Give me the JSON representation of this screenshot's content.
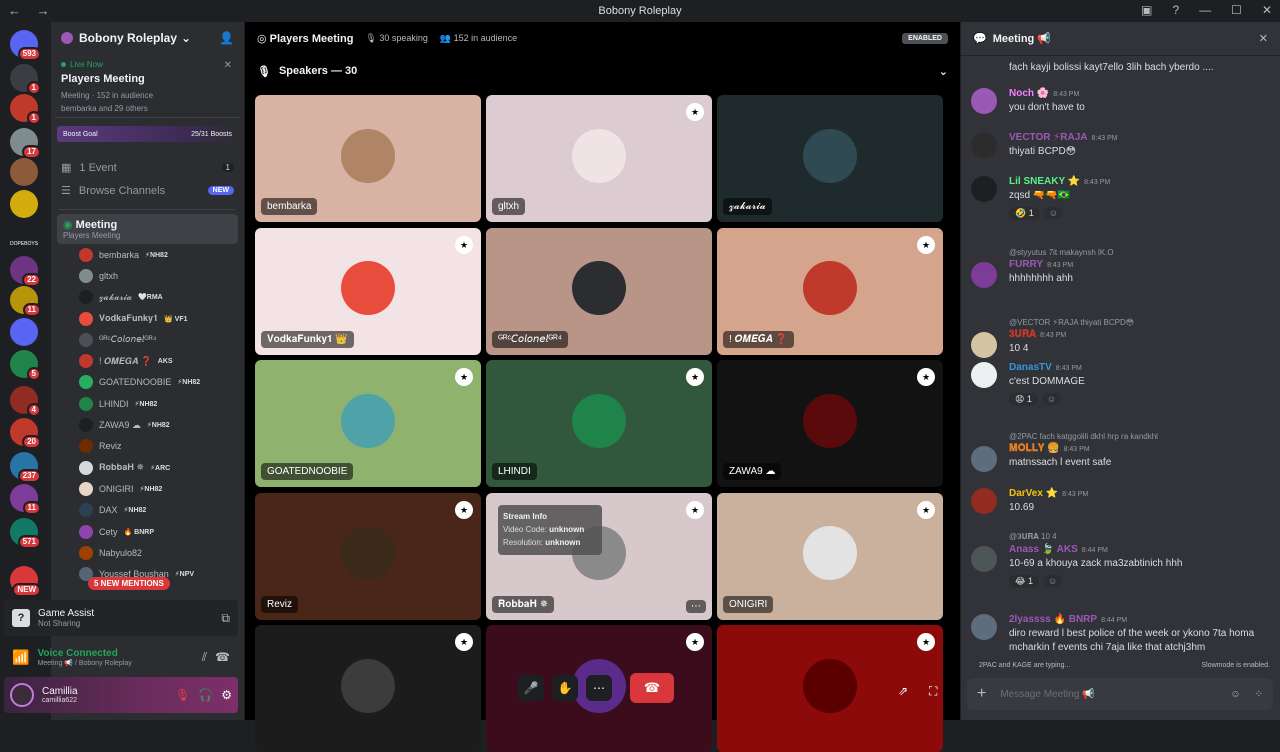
{
  "window": {
    "title": "Bobony Roleplay",
    "nav": "← →"
  },
  "guilds": [
    {
      "badge": "593",
      "color": "#5865f2"
    },
    {
      "badge": "1",
      "color": "#3a3d44"
    },
    {
      "badge": "1",
      "color": "#c0392b"
    },
    {
      "badge": "17",
      "color": "#7f8c8d"
    },
    {
      "badge": "",
      "color": "#8e5b3a"
    },
    {
      "badge": "",
      "color": "#d4ac0d"
    },
    {
      "label": "DOPEBOYS",
      "badge": "",
      "color": "#1e1f22"
    },
    {
      "badge": "22",
      "color": "#6c3483"
    },
    {
      "badge": "11",
      "color": "#b7950b"
    },
    {
      "badge": "",
      "color": "#5865f2"
    },
    {
      "badge": "5",
      "color": "#1e8449"
    },
    {
      "badge": "4",
      "color": "#922b21"
    },
    {
      "badge": "20",
      "color": "#c0392b"
    },
    {
      "badge": "237",
      "color": "#2874a6"
    },
    {
      "badge": "11",
      "color": "#7d3c98"
    },
    {
      "badge": "571",
      "color": "#117a65"
    },
    {
      "badge": "NEW",
      "color": "#da373c"
    }
  ],
  "server": {
    "name": "Bobony Roleplay",
    "live_label": "Live Now",
    "live_title": "Players Meeting",
    "live_meta_channel": "Meeting",
    "live_meta_audience": "152 in audience",
    "live_meta_members": "bembarka and 29 others",
    "boost_label": "Boost Goal",
    "boost_value": "25/31 Boosts",
    "events": "1 Event",
    "events_count": "1",
    "browse": "Browse Channels",
    "browse_badge": "NEW",
    "voice_channel": "Meeting",
    "voice_sub": "Players Meeting",
    "voice_users": [
      {
        "name": "bembarka",
        "tag": "⚡NH82",
        "color": "#c0392b"
      },
      {
        "name": "gltxh",
        "tag": "",
        "color": "#7f8c8d"
      },
      {
        "name": "𝔃𝓪𝓴𝓪𝓻𝓲𝓪",
        "tag": "🤍RMA",
        "color": "#1e1f22"
      },
      {
        "name": "𝐕𝐨𝐝𝐤𝐚𝐅𝐮𝐧𝐤𝐲𝟏",
        "tag": "👑 VF1",
        "color": "#e74c3c"
      },
      {
        "name": "ᴳᴿᶜ𝘊𝘰𝘭𝘰𝘯𝘦𝘭ᴳᴿ⁴",
        "tag": "",
        "color": "#4e5058"
      },
      {
        "name": "! 𝑶𝑴𝑬𝑮𝑨 ❓",
        "tag": "AKS",
        "color": "#c0392b"
      },
      {
        "name": "GOATEDNOOBIE",
        "tag": "⚡NH82",
        "color": "#27ae60"
      },
      {
        "name": "LHINDI",
        "tag": "⚡NH82",
        "color": "#1e8449"
      },
      {
        "name": "ZAWA9 ☁",
        "tag": "⚡NH82",
        "color": "#1e1f22"
      },
      {
        "name": "Reviz",
        "tag": "",
        "color": "#6e2c00"
      },
      {
        "name": "𝐑𝐨𝐛𝐛𝐚𝐇 ✵",
        "tag": "⚡ARC",
        "color": "#d5d8dc"
      },
      {
        "name": "ONIGIRI",
        "tag": "⚡NH82",
        "color": "#e8d5c4"
      },
      {
        "name": "DAX",
        "tag": "⚡NH82",
        "color": "#2e4053"
      },
      {
        "name": "Cety",
        "tag": "🔥 BNRP",
        "color": "#8e44ad"
      },
      {
        "name": "Nabyulo82",
        "tag": "",
        "color": "#a04000"
      },
      {
        "name": "Youssef Boushan",
        "tag": "⚡NPV",
        "color": "#566573"
      }
    ],
    "mentions": "5 NEW MENTIONS",
    "game_assist": "Game Assist",
    "game_assist_sub": "Not Sharing",
    "voice_connected": "Voice Connected",
    "voice_connected_sub": "Meeting 📢 / Bobony Roleplay",
    "user_name": "Camillia",
    "user_handle": "camillia622"
  },
  "stage": {
    "title": "Players Meeting",
    "speaking": "30 speaking",
    "audience": "152 in audience",
    "enabled": "ENABLED",
    "speakers": "Speakers — 30",
    "tiles": [
      {
        "name": "bembarka",
        "bg": "#d8b2a2",
        "av": "#b08566",
        "badge": false
      },
      {
        "name": "gltxh",
        "bg": "#dccbd0",
        "av": "#efe3e6",
        "badge": true
      },
      {
        "name": "𝔃𝓪𝓴𝓪𝓻𝓲𝓪",
        "bg": "#1f2a2c",
        "av": "#2f4a52",
        "badge": false
      },
      {
        "name": "𝐕𝐨𝐝𝐤𝐚𝐅𝐮𝐧𝐤𝐲𝟏 👑",
        "bg": "#f4e3e4",
        "av": "#e74c3c",
        "badge": true
      },
      {
        "name": "ᴳᴿᶜ𝘊𝘰𝘭𝘰𝘯𝘦𝘭ᴳᴿ⁴",
        "bg": "#b99588",
        "av": "#2b2d31",
        "badge": false
      },
      {
        "name": "! 𝑶𝑴𝑬𝑮𝑨 ❓",
        "bg": "#d5a48c",
        "av": "#c0392b",
        "badge": true
      },
      {
        "name": "GOATEDNOOBIE",
        "bg": "#8fb26f",
        "av": "#4fa3a8",
        "badge": true
      },
      {
        "name": "LHINDI",
        "bg": "#31573c",
        "av": "#1e8449",
        "badge": true
      },
      {
        "name": "ZAWA9 ☁",
        "bg": "#121212",
        "av": "#5a0a0a",
        "badge": true
      },
      {
        "name": "Reviz",
        "bg": "#4a2619",
        "av": "#3b2a1a",
        "badge": true
      },
      {
        "name": "𝐑𝐨𝐛𝐛𝐚𝐇 ✵",
        "bg": "#d7c9cb",
        "av": "#8a8a8a",
        "badge": true
      },
      {
        "name": "ONIGIRI",
        "bg": "#c9b19e",
        "av": "#e3e3e3",
        "badge": true
      },
      {
        "name": "",
        "bg": "#1c1c1c",
        "av": "#3c3c3c",
        "badge": true
      },
      {
        "name": "",
        "bg": "#3a0c1c",
        "av": "#5b2b8c",
        "badge": true
      },
      {
        "name": "",
        "bg": "#8c0a0a",
        "av": "#5a0000",
        "badge": true
      }
    ],
    "stream_info": {
      "title": "Stream Info",
      "codec_label": "Video Code:",
      "codec": "unknown",
      "res_label": "Resolution:",
      "res": "unknown"
    }
  },
  "chat": {
    "title": "Meeting 📢",
    "top_text": "fach kayji bolissi kayt7ello 3lih bach yberdo ....",
    "messages": [
      {
        "user": "Noch 🌸",
        "color": "#f47fff",
        "time": "8:43 PM",
        "text": "you don't have to",
        "av": "#9b59b6",
        "reply": "",
        "rx": ""
      },
      {
        "user": "VECTOR ⚡RAJA",
        "color": "#9b59b6",
        "time": "8:43 PM",
        "text": "thiyati BCPD😳",
        "av": "#2c2c2c",
        "reply": "",
        "rx": ""
      },
      {
        "user": "Lil SNEAKY ⭐",
        "color": "#57f287",
        "time": "8:43 PM",
        "text": "zqsd 🔫🔫🇧🇷",
        "av": "#1e1f22",
        "reply": "",
        "rx": "🤣 1"
      },
      {
        "user": "FURRY",
        "color": "#9b59b6",
        "time": "8:43 PM",
        "text": "hhhhhhhh ahh",
        "av": "#7d3c98",
        "reply": "@styyutus 7it makaynsh lK.O",
        "rx": ""
      },
      {
        "user": "𝟑𝐔𝐑𝐀",
        "color": "#c0392b",
        "time": "8:43 PM",
        "text": "10 4",
        "av": "#d5c4a1",
        "reply": "@VECTOR ⚡RAJA thiyati BCPD😳",
        "rx": ""
      },
      {
        "user": "DanasTV",
        "color": "#3498db",
        "time": "8:43 PM",
        "text": "c'est DOMMAGE",
        "av": "#ecf0f1",
        "reply": "",
        "rx": "😧 1"
      },
      {
        "user": "𝐌𝐎𝐋𝐋𝐘 🍔",
        "color": "#e67e22",
        "time": "8:43 PM",
        "text": "matnssach l event safe",
        "av": "#5d6d7e",
        "reply": "@2PAC fach katggolili dkhl hrp ra kandkhl",
        "rx": ""
      },
      {
        "user": "DarVex ⭐",
        "color": "#f1c40f",
        "time": "8:43 PM",
        "text": "10.69",
        "av": "#922b21",
        "reply": "",
        "rx": ""
      },
      {
        "user": "Anass 🍃 AKS",
        "color": "#9b59b6",
        "time": "8:44 PM",
        "text": "10-69 a khouya zack ma3zabtinich hhh",
        "av": "#4d5656",
        "reply": "@𝟑𝐔𝐑𝐀 10 4",
        "rx": "😂 1"
      },
      {
        "user": "2lyassss 🔥 BNRP",
        "color": "#9b59b6",
        "time": "8:44 PM",
        "text": "diro reward l best police of the week or ykono 7ta homa mcharkin f events chi 7aja like that atchj3hm",
        "av": "#5d6d7e",
        "reply": "",
        "rx": ""
      }
    ],
    "typing": "2PAC and KAGE are typing...",
    "slowmode": "Slowmode is enabled.",
    "placeholder": "Message Meeting 📢"
  }
}
